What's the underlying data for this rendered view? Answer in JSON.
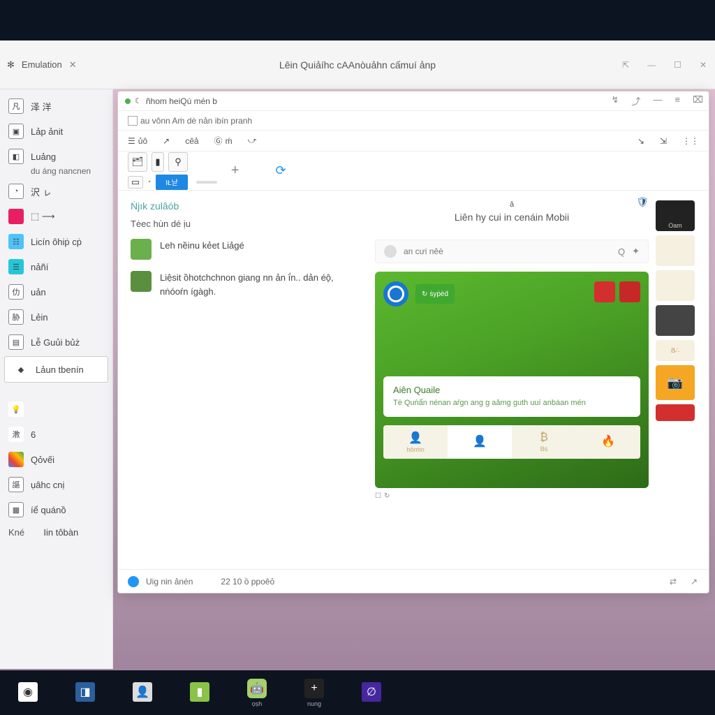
{
  "mainWindow": {
    "tabLabel": "Emulation",
    "title": "Lêin Quiảíhc cAAnòuảhn cấmuí ảnp"
  },
  "sidebar": {
    "items": [
      {
        "label": "泽 洋"
      },
      {
        "label": "Lảp ảnit"
      },
      {
        "label": "Luảng",
        "sub": "du áng nancnen"
      },
      {
        "label": "沢 ㇾ"
      },
      {
        "label": "⬚ ⟶"
      },
      {
        "label": "Licín ôhiṗ cṗ"
      },
      {
        "label": "nảñí"
      },
      {
        "label": "uản"
      },
      {
        "label": "Lẻin"
      },
      {
        "label": "Lễ Guủi bủż"
      },
      {
        "label": "Lảun tbenín",
        "selected": true
      },
      {
        "label": ""
      },
      {
        "label": "6"
      },
      {
        "label": "Qỏvếi"
      },
      {
        "label": "ụâhc cnị"
      },
      {
        "label": "íể quánồ"
      },
      {
        "label": "Iin tôbàn"
      }
    ],
    "footerLabel": "Kné"
  },
  "innerWindow": {
    "title": "ñhom heiQú mén b",
    "breadcrumb": "au vônn Aṁ dè nản ibín pranh",
    "menu": [
      "ủô",
      "cêả",
      "ḿ"
    ],
    "toolbarButtonLabel": "IŁ낟",
    "content": {
      "linkTitle": "Ṅjık zulâób",
      "subTitle": "Tėec hùn dé ịu",
      "items": [
        {
          "text": "Leh nềinu kẻet Liảgé"
        },
        {
          "text": "Liệsit ồhotchchnon giang nn ản ḯn.. dản éộ̣, nṅóoŕn ígàgh."
        }
      ]
    },
    "preview": {
      "diacritic": "ả",
      "title": "Liên hy cui in cenáin Mobii",
      "searchPlaceholder": "an cưi nêè",
      "card": {
        "badgeLabel": "ṡyṗèḋ",
        "msgTitle": "Aiên Quaile",
        "msgBody": "Tė Quṅẩn nénan aŕgn ang g aảmg guth uuí anbẚan mén",
        "tabs": [
          "hôrṁn",
          "",
          "Bṡ",
          ""
        ]
      },
      "thumbs": {
        "label": "Oam"
      }
    },
    "status": {
      "text": "Uig nin ảnén",
      "count": "22 10 ồ ppoêỏ"
    }
  },
  "taskbar": {
    "apps": [
      "",
      "",
      "",
      "",
      "ọṣh",
      "nung",
      ""
    ]
  }
}
